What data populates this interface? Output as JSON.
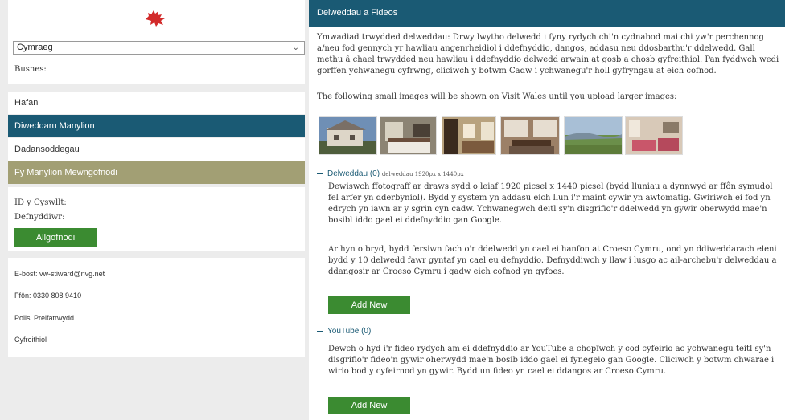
{
  "sidebar": {
    "language_select": "Cymraeg",
    "business_label": "Busnes:",
    "nav": [
      {
        "label": "Hafan"
      },
      {
        "label": "Diweddaru Manylion"
      },
      {
        "label": "Dadansoddegau"
      },
      {
        "label": "Fy Manylion Mewngofnodi"
      }
    ],
    "login": {
      "id_label": "ID y Cyswllt:",
      "user_label": "Defnyddiwr:",
      "button": "Allgofnodi"
    },
    "contact": {
      "email": "E-bost: vw-stiward@nvg.net",
      "phone": "Ffôn: 0330 808 9410",
      "privacy": "Polisi Preifatrwydd",
      "legal": "Cyfreithiol"
    }
  },
  "main": {
    "header": "Delweddau a Fideos",
    "license_text": "Ymwadiad trwydded delweddau: Drwy lwytho delwedd i fyny rydych chi'n cydnabod mai chi yw'r perchennog a/neu fod gennych yr hawliau angenrheidiol i ddefnyddio, dangos, addasu neu ddosbarthu'r ddelwedd. Gall methu â chael trwydded neu hawliau i ddefnyddio delwedd arwain at gosb a chosb gyfreithiol. Pan fyddwch wedi gorffen ychwanegu cyfrwng, cliciwch y botwm Cadw i ychwanegu'r holl gyfryngau at eich cofnod.",
    "small_images_text": "The following small images will be shown on Visit Wales until you upload larger images:",
    "images_section": {
      "title": "Delweddau (0)",
      "subtitle": "delweddau 1920px x 1440px",
      "para1": "Dewiswch ffotograff ar draws sydd o leiaf 1920 picsel x 1440 picsel (bydd lluniau a dynnwyd ar ffôn symudol fel arfer yn dderbyniol). Bydd y system yn addasu eich llun i'r maint cywir yn awtomatig. Gwiriwch ei fod yn edrych yn iawn ar y sgrin cyn cadw. Ychwanegwch deitl sy'n disgrifio'r ddelwedd yn gywir oherwydd mae'n bosibl iddo gael ei ddefnyddio gan Google.",
      "para2": "Ar hyn o bryd, bydd fersiwn fach o'r ddelwedd yn cael ei hanfon at Croeso Cymru, ond yn ddiweddarach eleni bydd y 10 delwedd fawr gyntaf yn cael eu defnyddio. Defnyddiwch y llaw i lusgo ac ail-archebu'r delweddau a ddangosir ar Croeso Cymru i gadw eich cofnod yn gyfoes.",
      "button": "Add New"
    },
    "youtube_section": {
      "title": "YouTube (0)",
      "para": "Dewch o hyd i'r fideo rydych am ei ddefnyddio ar YouTube a chopïwch y cod cyfeirio ac ychwanegu teitl sy'n disgrifio'r fideo'n gywir oherwydd mae'n bosib iddo gael ei fynegeio gan Google. Cliciwch y botwm chwarae i wirio bod y cyfeirnod yn gywir. Bydd un fideo yn cael ei ddangos ar Croeso Cymru.",
      "button": "Add New"
    }
  },
  "thumbnails": [
    "house-photo",
    "bedroom-photo",
    "living-room-photo",
    "dining-room-photo",
    "countryside-photo",
    "lounge-photo"
  ],
  "colors": {
    "accent": "#1a5a74",
    "login_bar": "#a29f74",
    "button": "#3b8b31",
    "dragon": "#d22a2a"
  }
}
